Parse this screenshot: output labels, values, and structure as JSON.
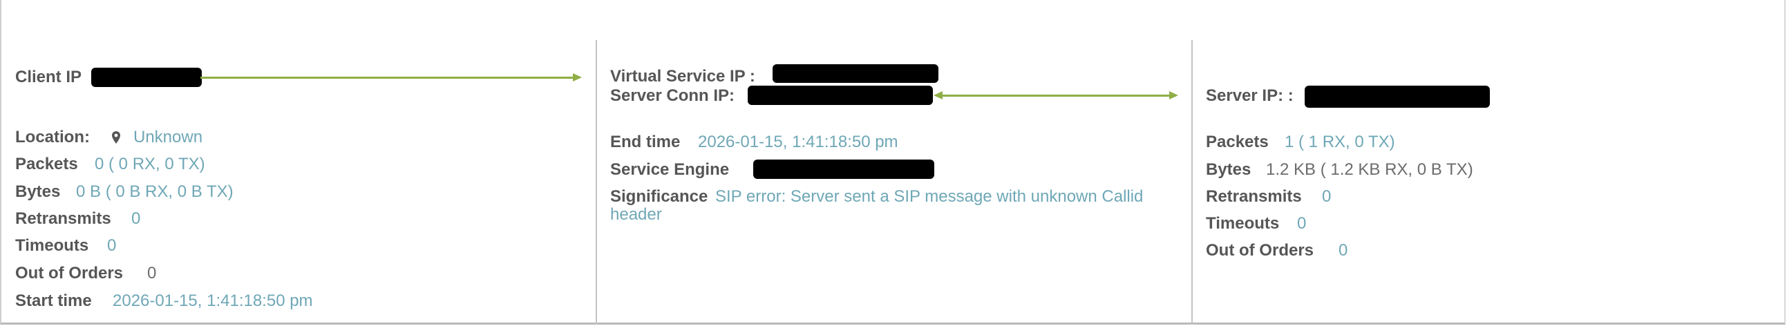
{
  "client": {
    "ip_label": "Client IP",
    "location_label": "Location:",
    "location_value": "Unknown",
    "packets_label": "Packets",
    "packets_value": "0 ( 0 RX, 0 TX)",
    "bytes_label": "Bytes",
    "bytes_value": "0 B ( 0 B RX, 0 B TX)",
    "retransmits_label": "Retransmits",
    "retransmits_value": "0",
    "timeouts_label": "Timeouts",
    "timeouts_value": "0",
    "out_of_orders_label": "Out of Orders",
    "out_of_orders_value": "0",
    "start_time_label": "Start time",
    "start_time_value": "2026-01-15, 1:41:18:50 pm"
  },
  "virtual_service": {
    "vs_ip_label": "Virtual Service IP :",
    "conn_ip_label": "Server Conn IP:",
    "end_time_label": "End time",
    "end_time_value": "2026-01-15, 1:41:18:50 pm",
    "service_engine_label": "Service Engine",
    "significance_label": "Significance",
    "significance_value": "SIP error: Server sent a SIP message with unknown Callid header"
  },
  "server": {
    "ip_label": "Server IP: :",
    "packets_label": "Packets",
    "packets_value": "1 ( 1 RX, 0 TX)",
    "bytes_label": "Bytes",
    "bytes_value": "1.2 KB ( 1.2 KB RX, 0 B TX)",
    "retransmits_label": "Retransmits",
    "retransmits_value": "0",
    "timeouts_label": "Timeouts",
    "timeouts_value": "0",
    "out_of_orders_label": "Out of Orders",
    "out_of_orders_value": "0"
  },
  "icons": {
    "location": "map-pin-icon",
    "client_flow": "arrow-right-icon",
    "server_flow": "double-arrow-icon"
  },
  "colors": {
    "link_value": "#6fa7b6",
    "arrow": "#8fae45",
    "label": "#565656"
  }
}
